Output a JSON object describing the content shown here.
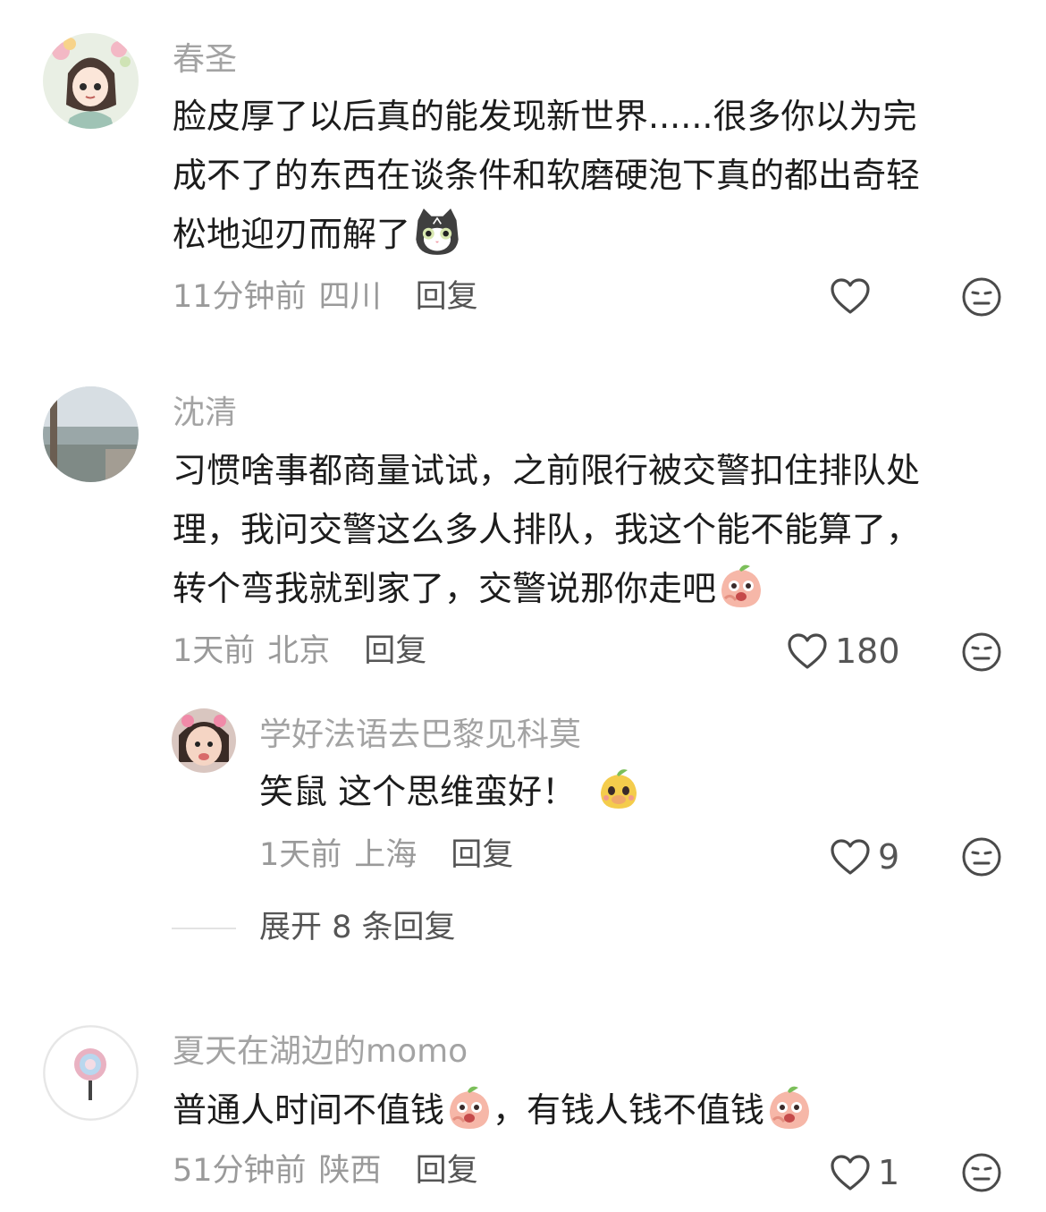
{
  "comments": [
    {
      "username": "春圣",
      "text": [
        "脸皮厚了以后真的能发现新世界......很多你以为完",
        "成不了的东西在谈条件和软磨硬泡下真的都出奇轻",
        "松地迎刃而解了"
      ],
      "emoji": "cat-emoji",
      "time": "11分钟前",
      "location": "四川",
      "reply_label": "回复",
      "likes": ""
    },
    {
      "username": "沈清",
      "text": [
        "习惯啥事都商量试试，之前限行被交警扣住排队处",
        "理，我问交警这么多人排队，我这个能不能算了，",
        "转个弯我就到家了，交警说那你走吧"
      ],
      "emoji": "peach-laugh-emoji",
      "time": "1天前",
      "location": "北京",
      "reply_label": "回复",
      "likes": "180",
      "replies": [
        {
          "username": "学好法语去巴黎见科莫",
          "text": "笑鼠 这个思维蛮好！",
          "emoji": "yellow-pear-emoji",
          "time": "1天前",
          "location": "上海",
          "reply_label": "回复",
          "likes": "9"
        }
      ],
      "expand_label": "展开 8 条回复"
    },
    {
      "username": "夏天在湖边的momo",
      "text_parts": [
        "普通人时间不值钱",
        "，有钱人钱不值钱"
      ],
      "emoji": "peach-laugh-emoji",
      "time": "51分钟前",
      "location": "陕西",
      "reply_label": "回复",
      "likes": "1"
    }
  ],
  "icons": {
    "like": "heart-outline-icon",
    "dislike": "meh-face-icon"
  },
  "colors": {
    "username": "#a3a3a3",
    "text": "#1c1c1c",
    "meta": "#9a9a9a",
    "reply": "#555555",
    "icon": "#4a4a4a"
  }
}
